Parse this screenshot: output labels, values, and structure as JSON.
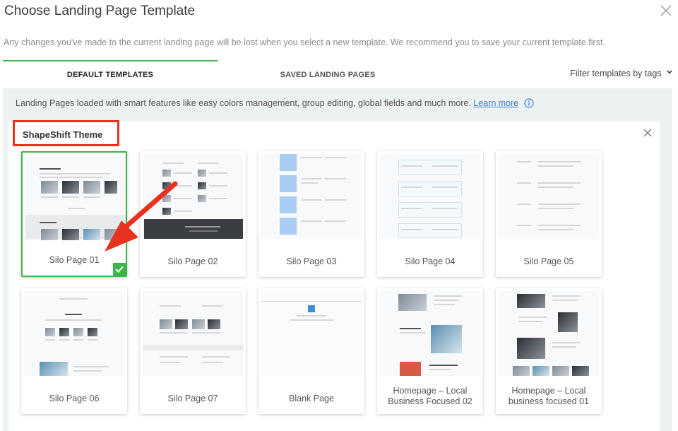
{
  "dialog": {
    "title": "Choose Landing Page Template",
    "notice": "Any changes you've made to the current landing page will be lost when you select a new template. We recommend you to save your current template first."
  },
  "tabs": [
    {
      "label": "DEFAULT TEMPLATES",
      "active": true
    },
    {
      "label": "SAVED LANDING PAGES",
      "active": false
    }
  ],
  "filter": {
    "label": "Filter templates by tags"
  },
  "info": {
    "text": "Landing Pages loaded with smart features like easy colors management, group editing, global fields and much more.",
    "link": "Learn more"
  },
  "theme": {
    "name": "ShapeShift Theme"
  },
  "templates": [
    {
      "label": "Silo Page 01",
      "selected": true
    },
    {
      "label": "Silo Page 02",
      "selected": false
    },
    {
      "label": "Silo Page 03",
      "selected": false
    },
    {
      "label": "Silo Page 04",
      "selected": false
    },
    {
      "label": "Silo Page 05",
      "selected": false
    },
    {
      "label": "Silo Page 06",
      "selected": false
    },
    {
      "label": "Silo Page 07",
      "selected": false
    },
    {
      "label": "Blank Page",
      "selected": false
    },
    {
      "label": "Homepage – Local Business Focused 02",
      "selected": false
    },
    {
      "label": "Homepage – Local business focused 01",
      "selected": false
    }
  ],
  "colors": {
    "accent": "#3ab54a",
    "highlight": "#e8321e",
    "link": "#3b7dd8",
    "panel": "#ecf1f1"
  }
}
